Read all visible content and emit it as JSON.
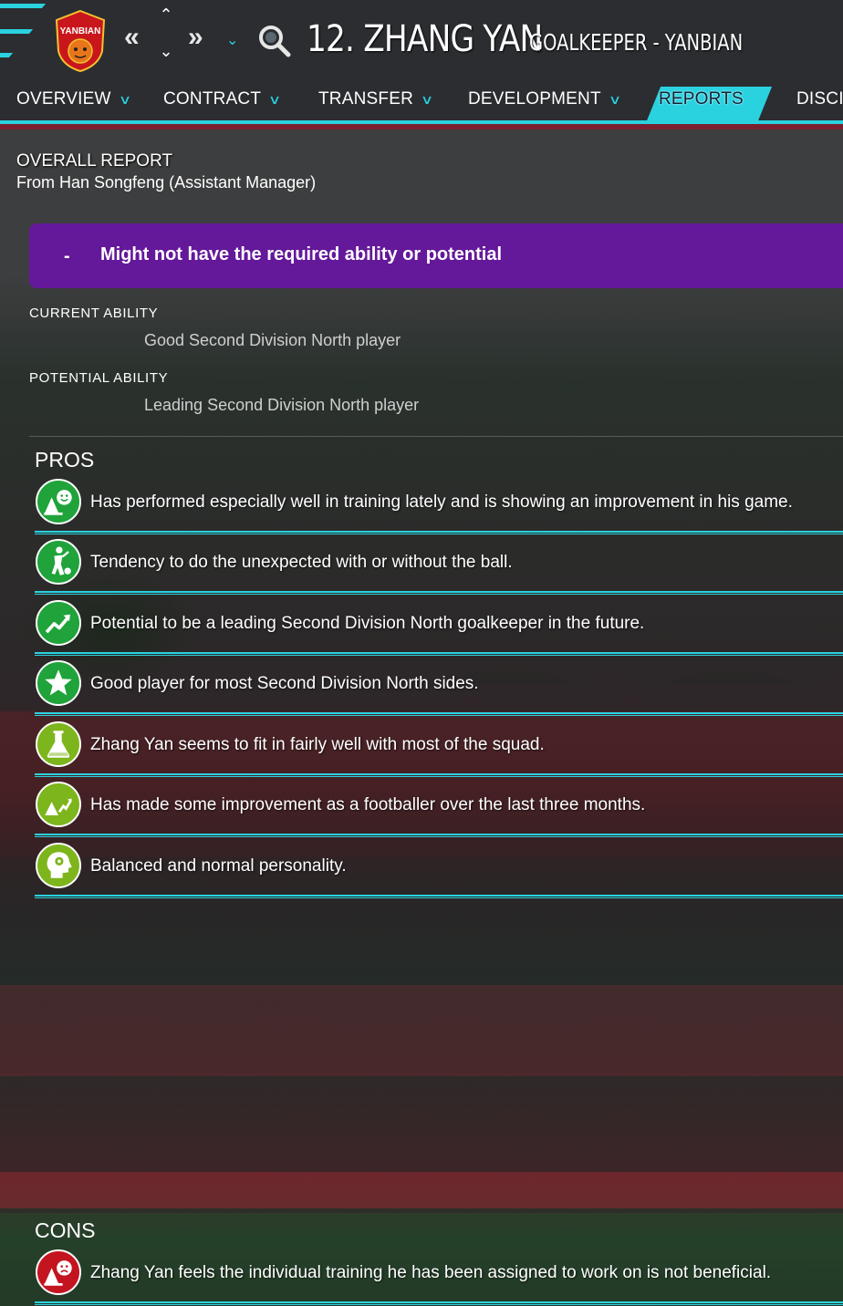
{
  "header": {
    "player_name": "12. ZHANG YAN",
    "position_club": "GOALKEEPER - YANBIAN",
    "club_badge_text": "YANBIAN",
    "back_icon": "double-chevron-left-icon",
    "forward_icon": "double-chevron-right-icon",
    "search_icon": "magnifier-icon",
    "accent_color": "#2ad2e0"
  },
  "tabs": [
    {
      "label": "OVERVIEW",
      "has_dropdown": true
    },
    {
      "label": "CONTRACT",
      "has_dropdown": true
    },
    {
      "label": "TRANSFER",
      "has_dropdown": true
    },
    {
      "label": "DEVELOPMENT",
      "has_dropdown": true
    },
    {
      "label": "REPORTS",
      "active": true
    },
    {
      "label": "DISCI",
      "has_dropdown": false
    }
  ],
  "report": {
    "title": "OVERALL REPORT",
    "from": "From Han Songfeng (Assistant Manager)",
    "verdict_marker": "-",
    "verdict": "Might not have the required ability or potential",
    "verdict_color": "#64189a",
    "current_ability_label": "CURRENT ABILITY",
    "current_ability_value": "Good Second Division North player",
    "potential_ability_label": "POTENTIAL ABILITY",
    "potential_ability_value": "Leading Second Division North player"
  },
  "pros": {
    "title": "PROS",
    "items": [
      {
        "text": "Has performed especially well in training lately and is showing an improvement in his game.",
        "icon": "training-happy-icon",
        "color": "#1fa33a"
      },
      {
        "text": "Tendency to do the unexpected with or without the ball.",
        "icon": "flair-player-icon",
        "color": "#1fa33a"
      },
      {
        "text": "Potential to be a leading Second Division North goalkeeper in the future.",
        "icon": "rising-trend-icon",
        "color": "#1fa33a"
      },
      {
        "text": "Good player for most Second Division North sides.",
        "icon": "star-icon",
        "color": "#1fa33a"
      },
      {
        "text": "Zhang Yan seems to fit in fairly well with most of the squad.",
        "icon": "flask-icon",
        "color": "#7db51c"
      },
      {
        "text": "Has made some improvement as a footballer over the last three months.",
        "icon": "progress-icon",
        "color": "#7db51c"
      },
      {
        "text": "Balanced and normal personality.",
        "icon": "personality-head-icon",
        "color": "#7db51c"
      }
    ]
  },
  "cons": {
    "title": "CONS",
    "items": [
      {
        "text": "Zhang Yan feels the individual training he has been assigned to work on is not beneficial.",
        "icon": "training-unhappy-icon",
        "color": "#c4141f"
      }
    ]
  }
}
